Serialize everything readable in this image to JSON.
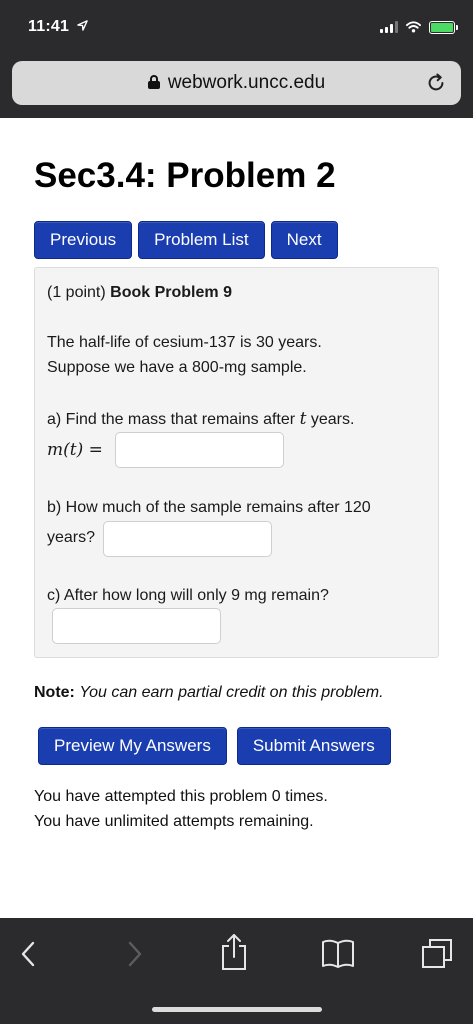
{
  "status_bar": {
    "time": "11:41",
    "location_icon": "location-arrow-icon",
    "signal_icon": "cellular-signal-icon",
    "wifi_icon": "wifi-icon",
    "battery_icon": "battery-charging-icon"
  },
  "browser": {
    "url": "webwork.uncc.edu",
    "lock_icon": "lock-icon",
    "reload_icon": "reload-icon"
  },
  "page": {
    "title": "Sec3.4: Problem 2",
    "nav": {
      "previous": "Previous",
      "problem_list": "Problem List",
      "next": "Next"
    },
    "problem": {
      "points": "(1 point)",
      "book_ref": "Book Problem 9",
      "statement_line1": "The half-life of cesium-137 is 30 years.",
      "statement_line2": "Suppose we have a 800-mg sample.",
      "part_a_prefix": "a) Find the mass that remains after",
      "part_a_var": "t",
      "part_a_suffix": "years.",
      "part_a_lhs": "m(t) =",
      "part_a_answer": "",
      "part_b_line1": "b) How much of the sample remains after 120",
      "part_b_line2": "years?",
      "part_b_answer": "",
      "part_c": "c) After how long will only 9 mg remain?",
      "part_c_answer": ""
    },
    "note_label": "Note:",
    "note_text": "You can earn partial credit on this problem.",
    "preview_button": "Preview My Answers",
    "submit_button": "Submit Answers",
    "attempts_line1": "You have attempted this problem 0 times.",
    "attempts_line2": "You have unlimited attempts remaining."
  },
  "toolbar": {
    "back_icon": "back-chevron-icon",
    "forward_icon": "forward-chevron-icon",
    "share_icon": "share-icon",
    "bookmarks_icon": "bookmarks-book-icon",
    "tabs_icon": "tabs-icon"
  },
  "colors": {
    "button_blue": "#1a3db0",
    "chrome_dark": "#2b2b2d",
    "panel_bg": "#f4f4f4",
    "battery_green": "#4cd964"
  }
}
